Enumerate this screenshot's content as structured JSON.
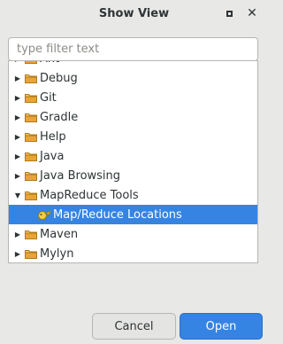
{
  "window": {
    "title": "Show View",
    "maximize_icon": "maximize-icon",
    "close_label": "✕"
  },
  "filter": {
    "placeholder": "type filter text",
    "value": ""
  },
  "tree": {
    "items": [
      {
        "label": "Ant",
        "expanded": false,
        "level": 0
      },
      {
        "label": "Debug",
        "expanded": false,
        "level": 0
      },
      {
        "label": "Git",
        "expanded": false,
        "level": 0
      },
      {
        "label": "Gradle",
        "expanded": false,
        "level": 0
      },
      {
        "label": "Help",
        "expanded": false,
        "level": 0
      },
      {
        "label": "Java",
        "expanded": false,
        "level": 0
      },
      {
        "label": "Java Browsing",
        "expanded": false,
        "level": 0
      },
      {
        "label": "MapReduce Tools",
        "expanded": true,
        "level": 0
      },
      {
        "label": "Map/Reduce Locations",
        "level": 1,
        "selected": true
      },
      {
        "label": "Maven",
        "expanded": false,
        "level": 0
      },
      {
        "label": "Mylyn",
        "expanded": false,
        "level": 0
      }
    ]
  },
  "buttons": {
    "cancel": "Cancel",
    "open": "Open"
  },
  "colors": {
    "selection": "#3584e4",
    "folder": "#e8a33a"
  }
}
